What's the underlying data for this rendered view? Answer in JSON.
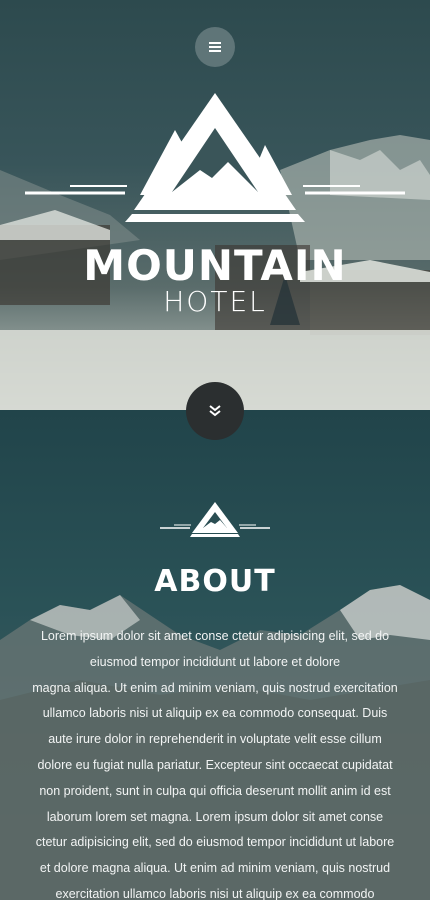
{
  "hero": {
    "brand_title": "MOUNTAIN",
    "brand_subtitle": "HOTEL",
    "menu_icon": "hamburger-icon",
    "scroll_icon": "double-chevron-down-icon"
  },
  "about": {
    "title": "ABOUT",
    "lines": [
      "Lorem ipsum dolor sit amet conse ctetur adipisicing elit, sed do",
      "eiusmod tempor incididunt ut labore et dolore",
      "magna aliqua. Ut enim ad minim veniam, quis nostrud exercitation",
      "ullamco laboris nisi ut aliquip ex ea commodo consequat. Duis",
      "aute irure dolor in reprehenderit in voluptate velit esse cillum",
      "dolore eu fugiat nulla pariatur. Excepteur sint occaecat cupidatat",
      "non proident, sunt in culpa qui officia deserunt mollit anim id est",
      "laborum lorem set magna. Lorem ipsum dolor sit amet conse",
      "ctetur adipisicing elit, sed do eiusmod tempor incididunt ut labore",
      "et dolore magna aliqua. Ut enim ad minim veniam, quis nostrud",
      "exercitation ullamco laboris nisi ut aliquip ex ea commodo"
    ]
  },
  "colors": {
    "hero_overlay": "#2d4a4e",
    "about_bg": "#21444a",
    "scroll_button": "#2b2f30",
    "menu_button": "#5f7578"
  }
}
